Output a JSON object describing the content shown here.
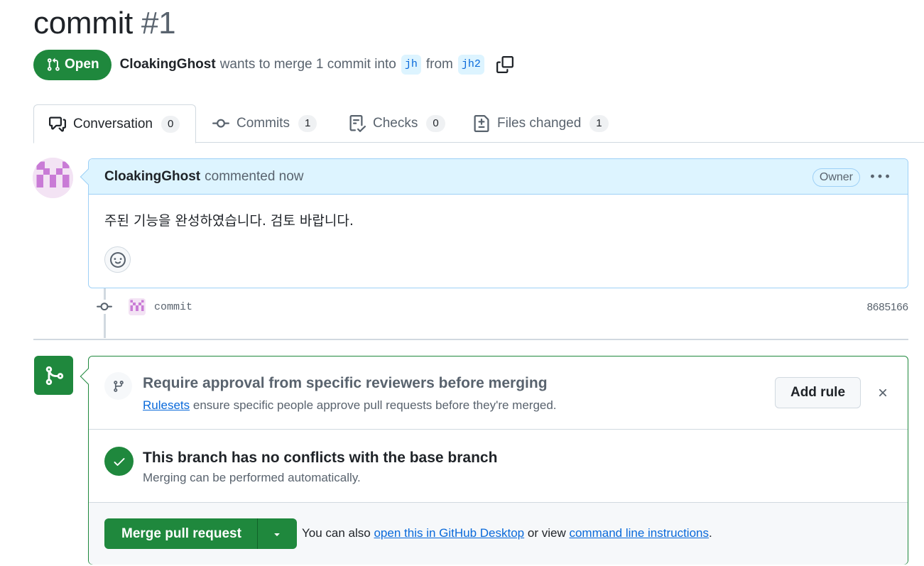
{
  "pr": {
    "title": "commit",
    "number": "#1",
    "state": "Open",
    "author": "CloakingGhost",
    "merge_text": "wants to merge 1 commit into",
    "base_branch": "jh",
    "from_text": "from",
    "head_branch": "jh2"
  },
  "tabs": [
    {
      "label": "Conversation",
      "count": "0",
      "icon": "comment-discussion-icon",
      "active": true
    },
    {
      "label": "Commits",
      "count": "1",
      "icon": "git-commit-icon"
    },
    {
      "label": "Checks",
      "count": "0",
      "icon": "checklist-icon"
    },
    {
      "label": "Files changed",
      "count": "1",
      "icon": "file-diff-icon"
    }
  ],
  "comment": {
    "author": "CloakingGhost",
    "action": "commented now",
    "role_badge": "Owner",
    "body": "주된 기능을 완성하였습니다. 검토 바랍니다."
  },
  "timeline": {
    "commit_message": "commit",
    "commit_sha": "8685166"
  },
  "merge_box": {
    "rule_title": "Require approval from specific reviewers before merging",
    "rule_link": "Rulesets",
    "rule_desc": "ensure specific people approve pull requests before they're merged.",
    "add_rule_label": "Add rule",
    "status_title": "This branch has no conflicts with the base branch",
    "status_desc": "Merging can be performed automatically.",
    "merge_button_label": "Merge pull request",
    "help_prefix": "You can also",
    "help_link1": "open this in GitHub Desktop",
    "help_middle": "or view",
    "help_link2": "command line instructions",
    "help_suffix": "."
  },
  "colors": {
    "accent_green": "#1f883d",
    "link_blue": "#0969da",
    "comment_header_bg": "#ddf4ff",
    "muted_text": "#59636e"
  }
}
